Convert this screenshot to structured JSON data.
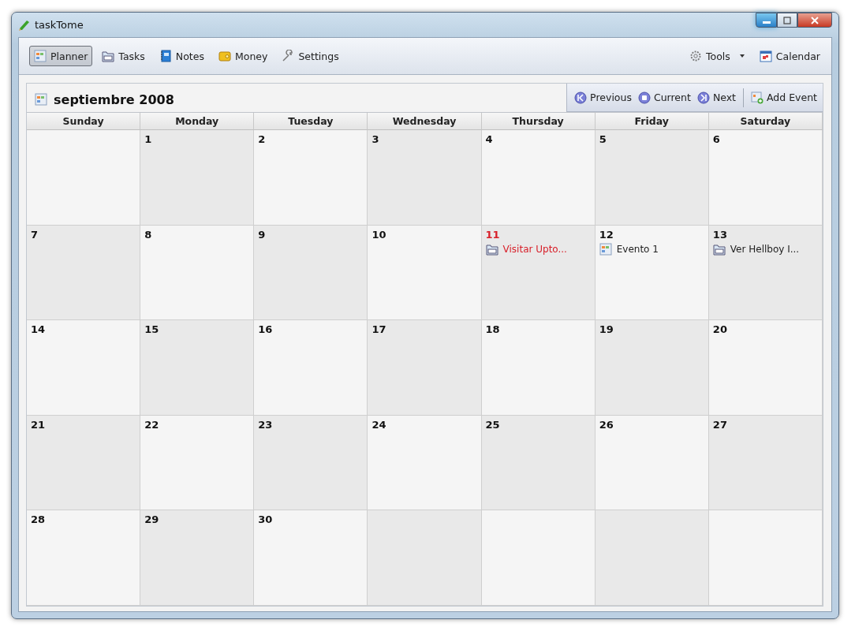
{
  "window": {
    "title": "taskTome"
  },
  "toolbar": {
    "items": [
      {
        "label": "Planner",
        "selected": true
      },
      {
        "label": "Tasks",
        "selected": false
      },
      {
        "label": "Notes",
        "selected": false
      },
      {
        "label": "Money",
        "selected": false
      },
      {
        "label": "Settings",
        "selected": false
      }
    ],
    "tools": {
      "label": "Tools"
    },
    "calendar": {
      "label": "Calendar"
    }
  },
  "calendar": {
    "title": "septiembre 2008",
    "nav": [
      {
        "label": "Previous"
      },
      {
        "label": "Current"
      },
      {
        "label": "Next"
      }
    ],
    "add": {
      "label": "Add Event"
    },
    "weekdays": [
      "Sunday",
      "Monday",
      "Tuesday",
      "Wednesday",
      "Thursday",
      "Friday",
      "Saturday"
    ],
    "weeks": [
      {
        "cells": [
          {
            "kind": "blank"
          },
          {
            "kind": "day",
            "number": "1"
          },
          {
            "kind": "day",
            "number": "2"
          },
          {
            "kind": "day",
            "number": "3"
          },
          {
            "kind": "day",
            "number": "4"
          },
          {
            "kind": "day",
            "number": "5"
          },
          {
            "kind": "day",
            "number": "6"
          }
        ]
      },
      {
        "cells": [
          {
            "kind": "day",
            "number": "7"
          },
          {
            "kind": "day",
            "number": "8"
          },
          {
            "kind": "day",
            "number": "9"
          },
          {
            "kind": "day",
            "number": "10"
          },
          {
            "kind": "day",
            "number": "11",
            "today": true,
            "events": [
              {
                "kind": "task",
                "title": "Visitar Upto..."
              }
            ]
          },
          {
            "kind": "day",
            "number": "12",
            "events": [
              {
                "kind": "event",
                "title": "Evento 1"
              }
            ]
          },
          {
            "kind": "day",
            "number": "13",
            "events": [
              {
                "kind": "task",
                "title": "Ver Hellboy I..."
              }
            ]
          }
        ]
      },
      {
        "cells": [
          {
            "kind": "day",
            "number": "14"
          },
          {
            "kind": "day",
            "number": "15"
          },
          {
            "kind": "day",
            "number": "16"
          },
          {
            "kind": "day",
            "number": "17"
          },
          {
            "kind": "day",
            "number": "18"
          },
          {
            "kind": "day",
            "number": "19"
          },
          {
            "kind": "day",
            "number": "20"
          }
        ]
      },
      {
        "cells": [
          {
            "kind": "day",
            "number": "21"
          },
          {
            "kind": "day",
            "number": "22"
          },
          {
            "kind": "day",
            "number": "23"
          },
          {
            "kind": "day",
            "number": "24"
          },
          {
            "kind": "day",
            "number": "25"
          },
          {
            "kind": "day",
            "number": "26"
          },
          {
            "kind": "day",
            "number": "27"
          }
        ]
      },
      {
        "cells": [
          {
            "kind": "day",
            "number": "28"
          },
          {
            "kind": "day",
            "number": "29"
          },
          {
            "kind": "day",
            "number": "30"
          },
          {
            "kind": "blank"
          },
          {
            "kind": "blank"
          },
          {
            "kind": "blank"
          },
          {
            "kind": "blank"
          }
        ]
      }
    ]
  }
}
